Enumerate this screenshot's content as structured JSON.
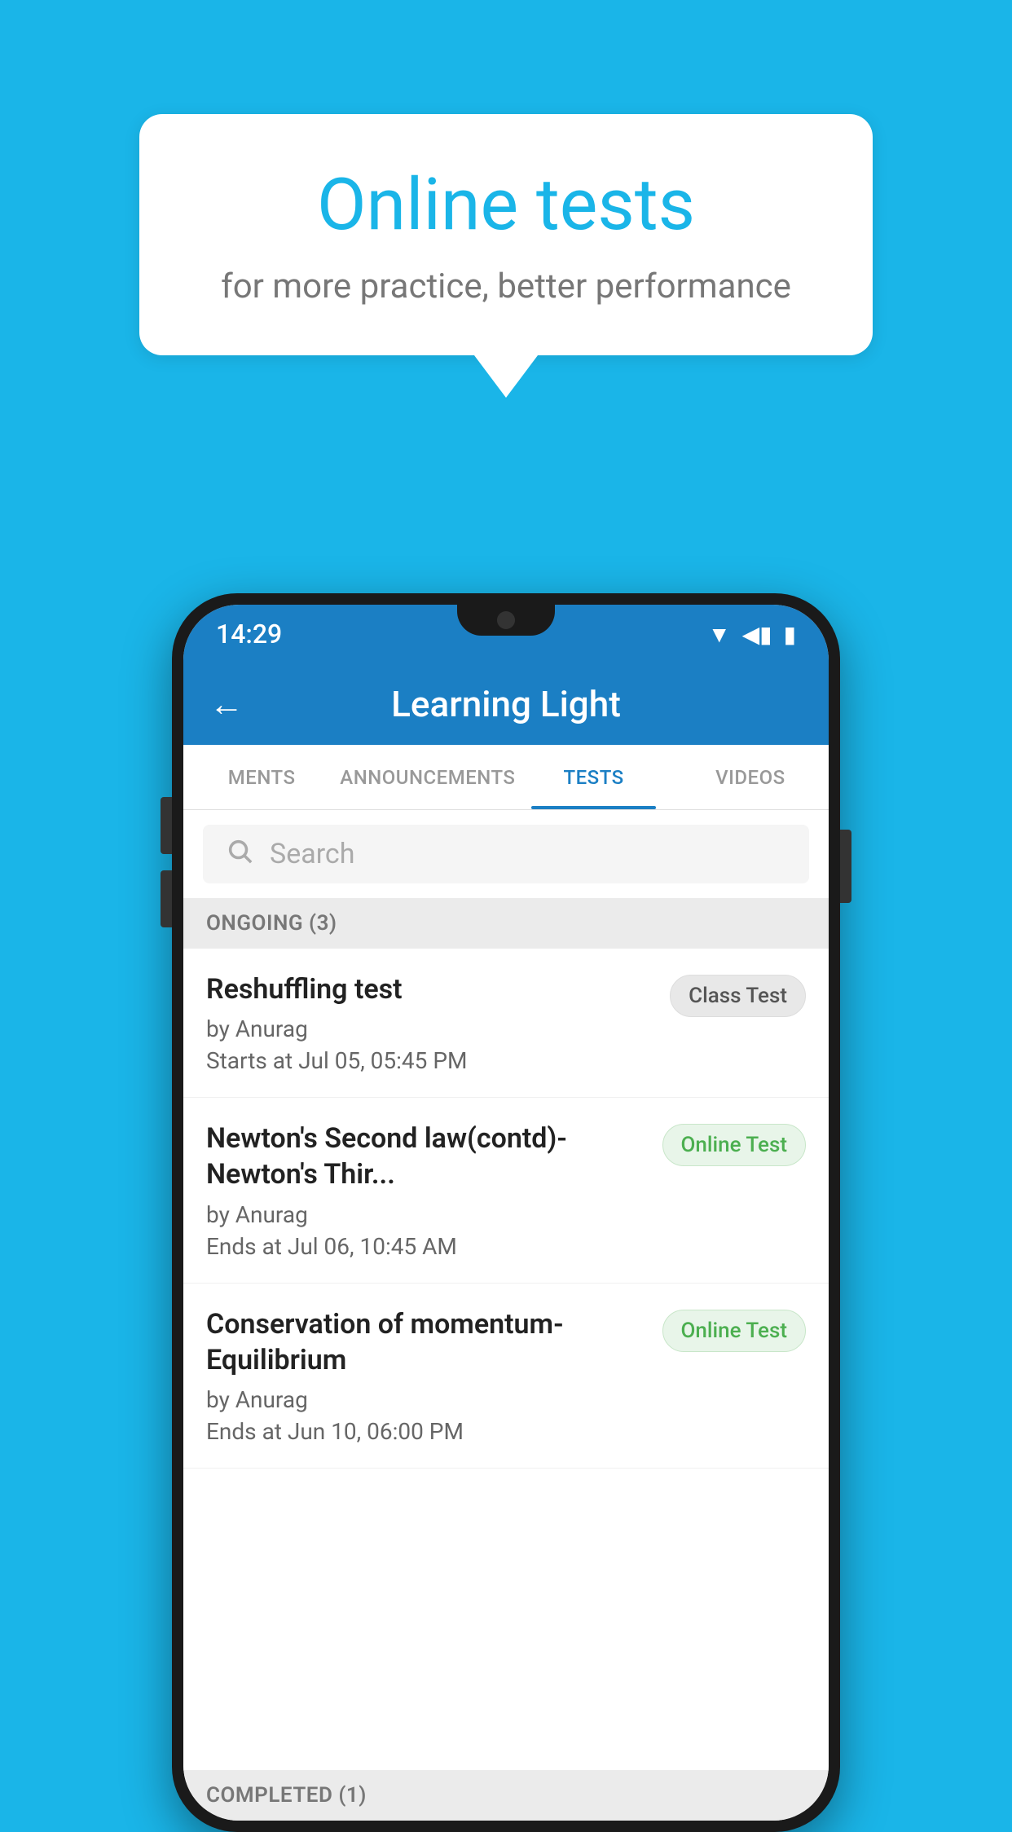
{
  "background_color": "#1ab5e8",
  "bubble": {
    "title": "Online tests",
    "subtitle": "for more practice, better performance"
  },
  "status_bar": {
    "time": "14:29",
    "wifi_icon": "▼",
    "signal_icon": "◀",
    "battery_icon": "▮"
  },
  "app_bar": {
    "back_icon": "←",
    "title": "Learning Light"
  },
  "tabs": [
    {
      "label": "MENTS",
      "active": false
    },
    {
      "label": "ANNOUNCEMENTS",
      "active": false
    },
    {
      "label": "TESTS",
      "active": true
    },
    {
      "label": "VIDEOS",
      "active": false
    }
  ],
  "search": {
    "placeholder": "Search"
  },
  "ongoing_section": {
    "label": "ONGOING (3)"
  },
  "tests": [
    {
      "title": "Reshuffling test",
      "author": "by Anurag",
      "date": "Starts at  Jul 05, 05:45 PM",
      "badge": "Class Test",
      "badge_type": "class"
    },
    {
      "title": "Newton's Second law(contd)-Newton's Thir...",
      "author": "by Anurag",
      "date": "Ends at  Jul 06, 10:45 AM",
      "badge": "Online Test",
      "badge_type": "online"
    },
    {
      "title": "Conservation of momentum-Equilibrium",
      "author": "by Anurag",
      "date": "Ends at  Jun 10, 06:00 PM",
      "badge": "Online Test",
      "badge_type": "online"
    }
  ],
  "completed_section": {
    "label": "COMPLETED (1)"
  }
}
